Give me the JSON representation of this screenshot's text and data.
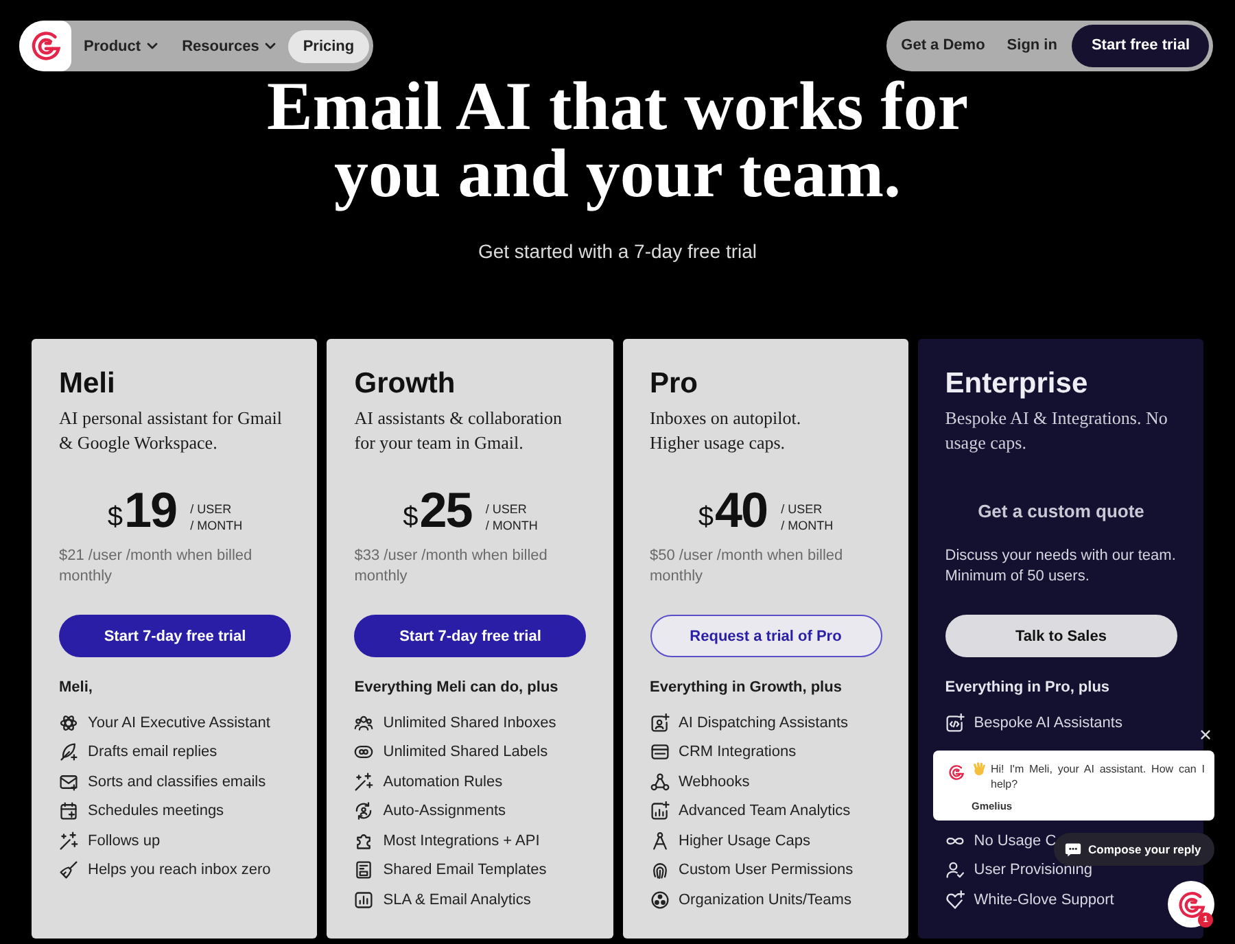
{
  "nav": {
    "menu": [
      {
        "label": "Product",
        "dropdown": true,
        "selected": false
      },
      {
        "label": "Resources",
        "dropdown": true,
        "selected": false
      },
      {
        "label": "Pricing",
        "dropdown": false,
        "selected": true
      }
    ],
    "actions": [
      {
        "label": "Get a Demo",
        "kind": "link"
      },
      {
        "label": "Sign in",
        "kind": "link"
      },
      {
        "label": "Start free trial",
        "kind": "primary"
      }
    ]
  },
  "hero": {
    "title": "Email AI that works for you and your team.",
    "subtitle": "Get started with a 7-day free trial"
  },
  "plans": [
    {
      "name": "Meli",
      "kind": "priced",
      "description": "AI personal assistant for Gmail & Google Workspace.",
      "price": {
        "currency": "$",
        "amount": "19",
        "units": [
          "/ USER",
          "/ MONTH"
        ]
      },
      "note": "$21 /user /month when billed monthly",
      "button": {
        "label": "Start 7-day free trial",
        "kind": "solid"
      },
      "features_heading": "Meli,",
      "features": [
        "Your AI Executive Assistant",
        "Drafts email replies",
        "Sorts and classifies emails",
        "Schedules meetings",
        "Follows up",
        "Helps you reach inbox zero"
      ]
    },
    {
      "name": "Growth",
      "kind": "priced",
      "description": "AI assistants & collaboration for your team in Gmail.",
      "price": {
        "currency": "$",
        "amount": "25",
        "units": [
          "/ USER",
          "/ MONTH"
        ]
      },
      "note": "$33 /user /month when billed monthly",
      "button": {
        "label": "Start 7-day free trial",
        "kind": "solid"
      },
      "features_heading": "Everything Meli can do, plus",
      "features": [
        "Unlimited Shared Inboxes",
        "Unlimited Shared Labels",
        "Automation Rules",
        "Auto-Assignments",
        "Most Integrations + API",
        "Shared Email Templates",
        "SLA & Email Analytics"
      ]
    },
    {
      "name": "Pro",
      "kind": "priced",
      "description": "Inboxes on autopilot.\nHigher usage caps.",
      "price": {
        "currency": "$",
        "amount": "40",
        "units": [
          "/ USER",
          "/ MONTH"
        ]
      },
      "note": "$50 /user /month when billed monthly",
      "button": {
        "label": "Request a trial of Pro",
        "kind": "outline"
      },
      "features_heading": "Everything in Growth, plus",
      "features": [
        "AI Dispatching Assistants",
        "CRM Integrations",
        "Webhooks",
        "Advanced Team Analytics",
        "Higher Usage Caps",
        "Custom User Permissions",
        "Organization Units/Teams"
      ]
    },
    {
      "name": "Enterprise",
      "kind": "custom",
      "description": "Bespoke AI & Integrations. No usage caps.",
      "quote": "Get a custom quote",
      "note": "Discuss your needs with our team. Minimum of 50 users.",
      "button": {
        "label": "Talk to Sales",
        "kind": "light"
      },
      "features_heading": "Everything in Pro, plus",
      "features": [
        "Bespoke AI Assistants",
        "No Usage C",
        "User Provisioning",
        "White-Glove Support"
      ]
    }
  ],
  "chat": {
    "message": "Hi! I'm Meli, your AI assistant. How can I help?",
    "sender": "Gmelius",
    "compose_label": "Compose your reply",
    "badge": "1"
  }
}
